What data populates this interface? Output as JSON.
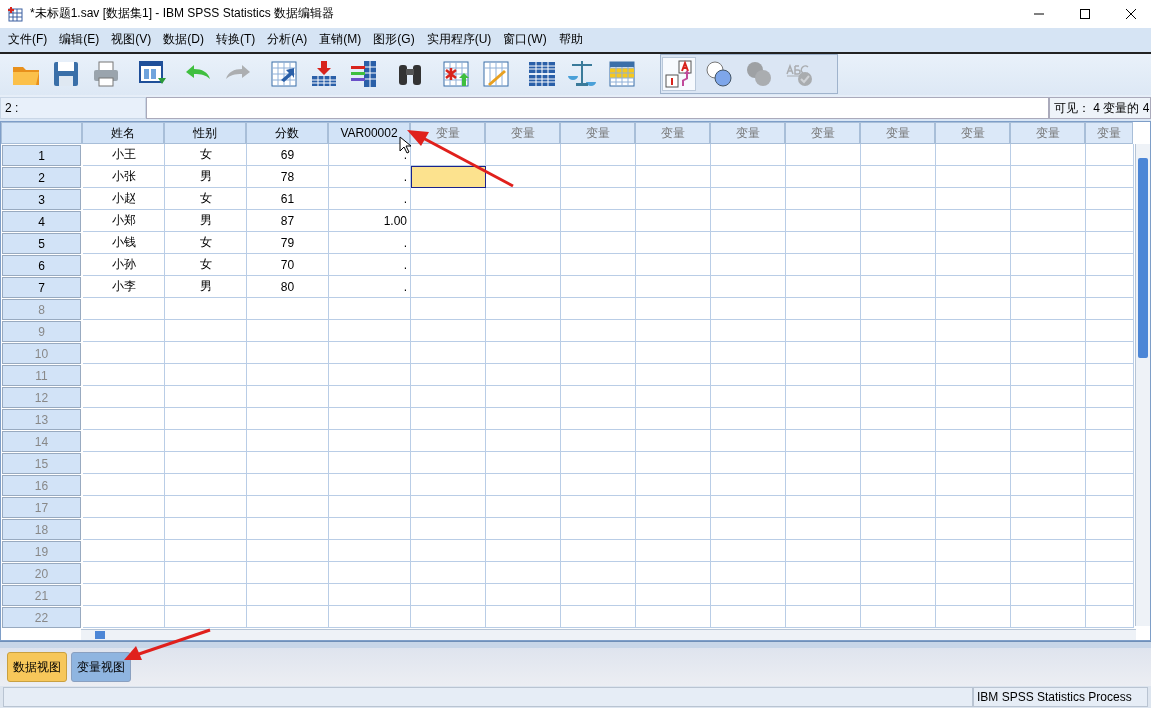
{
  "window": {
    "title": "*未标题1.sav [数据集1] - IBM SPSS Statistics 数据编辑器"
  },
  "menu": [
    "文件(F)",
    "编辑(E)",
    "视图(V)",
    "数据(D)",
    "转换(T)",
    "分析(A)",
    "直销(M)",
    "图形(G)",
    "实用程序(U)",
    "窗口(W)",
    "帮助"
  ],
  "toolbar": {
    "groups": [
      [
        {
          "kind": "open",
          "disabled": false,
          "pressed": false
        },
        {
          "kind": "save",
          "disabled": false,
          "pressed": false
        },
        {
          "kind": "print",
          "disabled": false,
          "pressed": false
        }
      ],
      [
        {
          "kind": "dialog",
          "disabled": false,
          "pressed": false
        }
      ],
      [
        {
          "kind": "undo",
          "disabled": false,
          "pressed": false
        },
        {
          "kind": "redo",
          "disabled": true,
          "pressed": false
        }
      ],
      [
        {
          "kind": "gotocase",
          "disabled": false,
          "pressed": false
        },
        {
          "kind": "gotovar",
          "disabled": false,
          "pressed": false
        },
        {
          "kind": "variables",
          "disabled": false,
          "pressed": false
        }
      ],
      [
        {
          "kind": "find",
          "disabled": false,
          "pressed": false
        }
      ],
      [
        {
          "kind": "insertcase",
          "disabled": false,
          "pressed": false
        },
        {
          "kind": "insertvar",
          "disabled": false,
          "pressed": false
        }
      ],
      [
        {
          "kind": "split",
          "disabled": false,
          "pressed": false
        },
        {
          "kind": "weight",
          "disabled": false,
          "pressed": false
        },
        {
          "kind": "select",
          "disabled": false,
          "pressed": false
        }
      ],
      [
        {
          "kind": "labels",
          "disabled": false,
          "pressed": true
        },
        {
          "kind": "sets",
          "disabled": false,
          "pressed": false
        },
        {
          "kind": "sets2",
          "disabled": true,
          "pressed": false
        },
        {
          "kind": "spell",
          "disabled": true,
          "pressed": false
        }
      ]
    ]
  },
  "cell_editor": {
    "reference": "2 :"
  },
  "visible_label": "可见： 4 变量的 4",
  "grid": {
    "columns": [
      {
        "label": "姓名",
        "kind": "text"
      },
      {
        "label": "性别",
        "kind": "text"
      },
      {
        "label": "分数",
        "kind": "text"
      },
      {
        "label": "VAR00002",
        "kind": "numeric"
      },
      {
        "label": "变量",
        "kind": "empty"
      },
      {
        "label": "变量",
        "kind": "empty"
      },
      {
        "label": "变量",
        "kind": "empty"
      },
      {
        "label": "变量",
        "kind": "empty"
      },
      {
        "label": "变量",
        "kind": "empty"
      },
      {
        "label": "变量",
        "kind": "empty"
      },
      {
        "label": "变量",
        "kind": "empty"
      },
      {
        "label": "变量",
        "kind": "empty"
      },
      {
        "label": "变量",
        "kind": "empty"
      },
      {
        "label": "变量",
        "kind": "empty"
      }
    ],
    "rows": [
      {
        "number": "1",
        "disabled": false,
        "cells": [
          {
            "text": "小王",
            "active": false
          },
          {
            "text": "女",
            "active": false
          },
          {
            "text": "69",
            "active": false
          },
          {
            "text": ".",
            "active": false
          }
        ]
      },
      {
        "number": "2",
        "disabled": false,
        "cells": [
          {
            "text": "小张",
            "active": false
          },
          {
            "text": "男",
            "active": false
          },
          {
            "text": "78",
            "active": false
          },
          {
            "text": ".",
            "active": false
          },
          {
            "active": true
          }
        ]
      },
      {
        "number": "3",
        "disabled": false,
        "cells": [
          {
            "text": "小赵",
            "active": false
          },
          {
            "text": "女",
            "active": false
          },
          {
            "text": "61",
            "active": false
          },
          {
            "text": ".",
            "active": false
          }
        ]
      },
      {
        "number": "4",
        "disabled": false,
        "cells": [
          {
            "text": "小郑",
            "active": false
          },
          {
            "text": "男",
            "active": false
          },
          {
            "text": "87",
            "active": false
          },
          {
            "text": "1.00",
            "active": false
          }
        ]
      },
      {
        "number": "5",
        "disabled": false,
        "cells": [
          {
            "text": "小钱",
            "active": false
          },
          {
            "text": "女",
            "active": false
          },
          {
            "text": "79",
            "active": false
          },
          {
            "text": ".",
            "active": false
          }
        ]
      },
      {
        "number": "6",
        "disabled": false,
        "cells": [
          {
            "text": "小孙",
            "active": false
          },
          {
            "text": "女",
            "active": false
          },
          {
            "text": "70",
            "active": false
          },
          {
            "text": ".",
            "active": false
          }
        ]
      },
      {
        "number": "7",
        "disabled": false,
        "cells": [
          {
            "text": "小李",
            "active": false
          },
          {
            "text": "男",
            "active": false
          },
          {
            "text": "80",
            "active": false
          },
          {
            "text": ".",
            "active": false
          }
        ]
      },
      {
        "number": "8",
        "disabled": true
      },
      {
        "number": "9",
        "disabled": true
      },
      {
        "number": "10",
        "disabled": true
      },
      {
        "number": "11",
        "disabled": true
      },
      {
        "number": "12",
        "disabled": true
      },
      {
        "number": "13",
        "disabled": true
      },
      {
        "number": "14",
        "disabled": true
      },
      {
        "number": "15",
        "disabled": true
      },
      {
        "number": "16",
        "disabled": true
      },
      {
        "number": "17",
        "disabled": true
      },
      {
        "number": "18",
        "disabled": true
      },
      {
        "number": "19",
        "disabled": true
      },
      {
        "number": "20",
        "disabled": true
      },
      {
        "number": "21",
        "disabled": true
      },
      {
        "number": "22",
        "disabled": true
      }
    ]
  },
  "view_tabs": [
    {
      "label": "数据视图",
      "selected": true
    },
    {
      "label": "变量视图",
      "selected": false
    }
  ],
  "status_bar": {
    "processor": "IBM SPSS Statistics Process"
  }
}
